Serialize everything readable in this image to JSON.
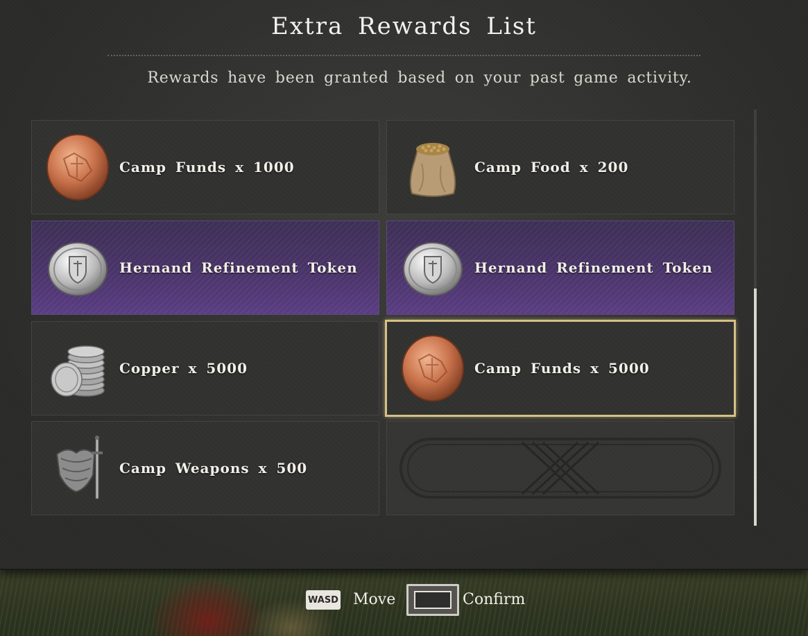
{
  "header": {
    "title": "Extra Rewards List",
    "subtitle": "Rewards have been granted based on your past game activity."
  },
  "rewards": [
    {
      "label": "Camp Funds x 1000",
      "icon": "camp-funds-coin-icon",
      "rarity": "common"
    },
    {
      "label": "Camp Food x 200",
      "icon": "grain-sack-icon",
      "rarity": "common"
    },
    {
      "label": "Hernand Refinement Token",
      "icon": "silver-crest-token-icon",
      "rarity": "epic"
    },
    {
      "label": "Hernand Refinement Token",
      "icon": "silver-crest-token-icon",
      "rarity": "epic"
    },
    {
      "label": "Copper x 5000",
      "icon": "coin-stack-icon",
      "rarity": "common"
    },
    {
      "label": "Camp Funds x 5000",
      "icon": "camp-funds-coin-icon",
      "rarity": "common",
      "selected": true
    },
    {
      "label": "Camp Weapons x 500",
      "icon": "armor-and-sword-icon",
      "rarity": "common"
    }
  ],
  "controls": {
    "move_key": "WASD",
    "move_label": "Move",
    "confirm_key_icon": "spacebar-key-icon",
    "confirm_label": "Confirm"
  },
  "colors": {
    "panel": "#2b2b29",
    "epic": "#4a3469",
    "selected_border": "#d5c186",
    "text": "#ecebe6"
  }
}
